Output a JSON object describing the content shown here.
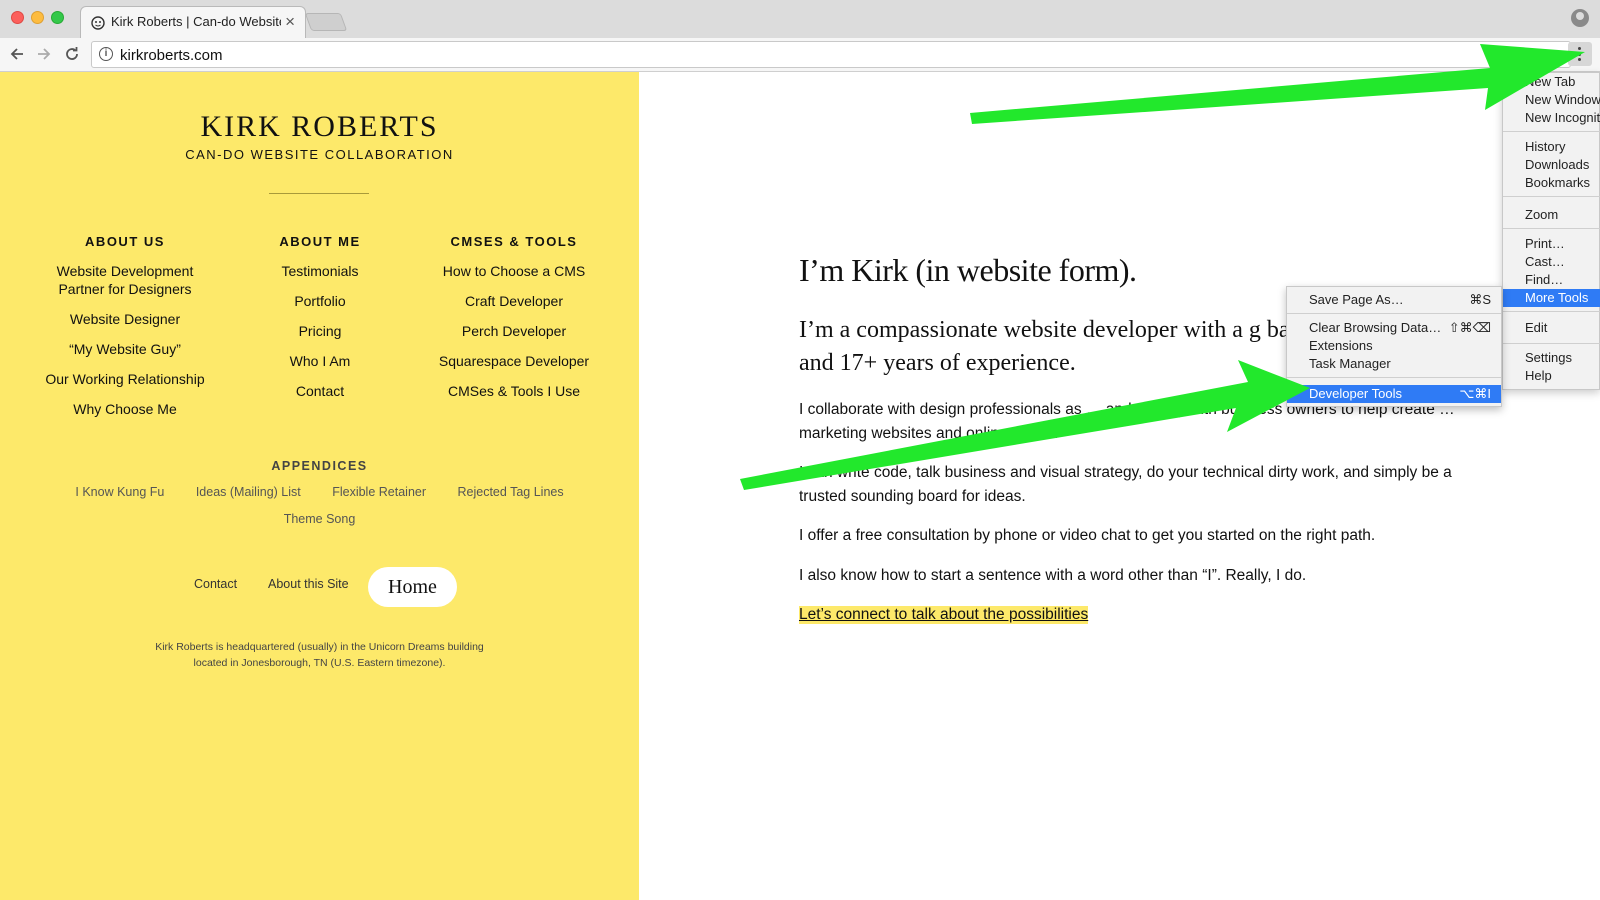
{
  "browser": {
    "tab_title": "Kirk Roberts | Can-do Website Collaboration",
    "tab_close": "×",
    "url": "kirkroberts.com",
    "info_glyph": "i"
  },
  "sidebar": {
    "brand": "KIRK ROBERTS",
    "tagline": "CAN-DO WEBSITE COLLABORATION",
    "columns": [
      {
        "heading": "ABOUT US",
        "links": [
          "Website Development Partner for Designers",
          "Website Designer",
          "“My Website Guy”",
          "Our Working Relationship",
          "Why Choose Me"
        ]
      },
      {
        "heading": "ABOUT ME",
        "links": [
          "Testimonials",
          "Portfolio",
          "Pricing",
          "Who I Am",
          "Contact"
        ]
      },
      {
        "heading": "CMSES & TOOLS",
        "links": [
          "How to Choose a CMS",
          "Craft Developer",
          "Perch Developer",
          "Squarespace Developer",
          "CMSes & Tools I Use"
        ]
      }
    ],
    "appendices": {
      "heading": "APPENDICES",
      "links": [
        "I Know Kung Fu",
        "Ideas (Mailing) List",
        "Flexible Retainer",
        "Rejected Tag Lines",
        "Theme Song"
      ]
    },
    "footer": {
      "contact": "Contact",
      "about_site": "About this Site",
      "home": "Home"
    },
    "address_line1": "Kirk Roberts is headquartered (usually) in the Unicorn Dreams building",
    "address_line2": "located in Jonesborough, TN (U.S. Eastern timezone)."
  },
  "main": {
    "heading": "I’m Kirk (in website form).",
    "lead": "I’m a compassionate website developer with a g background and 17+ years of experience.",
    "paragraphs": [
      "I collaborate with design professionals as … and directly with business owners to help create … marketing websites and online stores.",
      "I can write code, talk business and visual strategy, do your technical dirty work, and simply be a trusted sounding board for ideas.",
      "I offer a free consultation by phone or video chat to get you started on the right path.",
      "I also know how to start a sentence with a word other than “I”. Really, I do."
    ],
    "cta": "Let’s connect to talk about the possibilities"
  },
  "chrome_menu": {
    "items": [
      "New Tab",
      "New Window",
      "New Incognito",
      "History",
      "Downloads",
      "Bookmarks",
      "Zoom",
      "Print…",
      "Cast…",
      "Find…",
      "More Tools",
      "Edit",
      "Settings",
      "Help"
    ]
  },
  "more_tools_menu": {
    "items": [
      {
        "label": "Save Page As…",
        "shortcut": "⌘S"
      },
      {
        "label": "Clear Browsing Data…",
        "shortcut": "⇧⌘⌫"
      },
      {
        "label": "Extensions",
        "shortcut": ""
      },
      {
        "label": "Task Manager",
        "shortcut": ""
      },
      {
        "label": "Developer Tools",
        "shortcut": "⌥⌘I"
      }
    ]
  },
  "colors": {
    "sidebar_bg": "#fde96a",
    "menu_highlight": "#2f7bf5",
    "annotation_arrow": "#22e82c"
  }
}
